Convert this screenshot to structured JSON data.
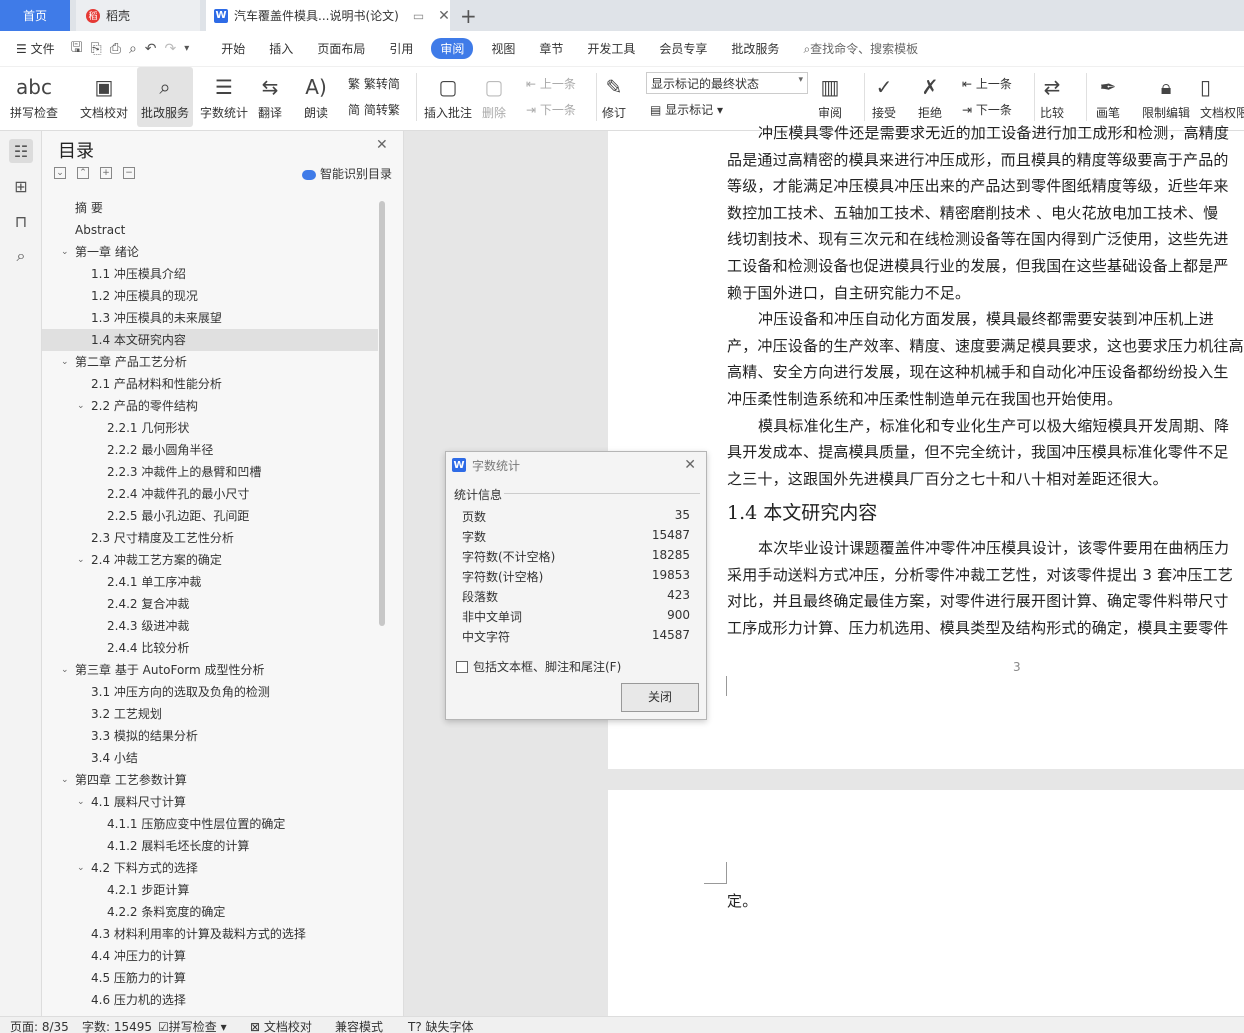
{
  "tabs": {
    "home": "首页",
    "daoke": "稻壳",
    "doc": "汽车覆盖件模具...说明书(论文)"
  },
  "menu": {
    "file": "文件",
    "items": [
      "开始",
      "插入",
      "页面布局",
      "引用",
      "审阅",
      "视图",
      "章节",
      "开发工具",
      "会员专享",
      "批改服务"
    ],
    "active_index": 4,
    "search": "查找命令、搜索模板"
  },
  "ribbon": {
    "spell": "拼写检查",
    "doc_check": "文档校对",
    "review_service": "批改服务",
    "word_count": "字数统计",
    "translate": "翻译",
    "read_aloud": "朗读",
    "trad": "繁转简",
    "simp": "简转繁",
    "insert_comment": "插入批注",
    "delete": "删除",
    "prev": "上一条",
    "next": "下一条",
    "revise": "修订",
    "mark_state": "显示标记的最终状态",
    "show_marks": "显示标记",
    "review": "审阅",
    "accept": "接受",
    "reject": "拒绝",
    "prev2": "上一条",
    "next2": "下一条",
    "compare": "比较",
    "pen": "画笔",
    "restrict": "限制编辑",
    "doc_rights": "文档权限"
  },
  "toc": {
    "title": "目录",
    "smart": "智能识别目录",
    "items": [
      {
        "t": "摘  要",
        "l": 0
      },
      {
        "t": "Abstract",
        "l": 0
      },
      {
        "t": "第一章  绪论",
        "l": 1
      },
      {
        "t": "1.1 冲压模具介绍",
        "l": 2
      },
      {
        "t": "1.2 冲压模具的现况",
        "l": 2
      },
      {
        "t": "1.3 冲压模具的未来展望",
        "l": 2
      },
      {
        "t": "1.4 本文研究内容",
        "l": 2,
        "sel": true
      },
      {
        "t": "第二章  产品工艺分析",
        "l": 1
      },
      {
        "t": "2.1 产品材料和性能分析",
        "l": 2
      },
      {
        "t": "2.2 产品的零件结构",
        "l": 3
      },
      {
        "t": "2.2.1  几何形状",
        "l": 4
      },
      {
        "t": "2.2.2 最小圆角半径",
        "l": 4
      },
      {
        "t": "2.2.3 冲裁件上的悬臂和凹槽",
        "l": 4
      },
      {
        "t": "2.2.4 冲裁件孔的最小尺寸",
        "l": 4
      },
      {
        "t": "2.2.5 最小孔边距、孔间距",
        "l": 4
      },
      {
        "t": "2.3 尺寸精度及工艺性分析",
        "l": 2
      },
      {
        "t": "2.4 冲裁工艺方案的确定",
        "l": 3
      },
      {
        "t": "2.4.1 单工序冲裁",
        "l": 4
      },
      {
        "t": "2.4.2 复合冲裁",
        "l": 4
      },
      {
        "t": "2.4.3 级进冲裁",
        "l": 4
      },
      {
        "t": "2.4.4 比较分析",
        "l": 4
      },
      {
        "t": "第三章  基于 AutoForm 成型性分析",
        "l": 1
      },
      {
        "t": "3.1  冲压方向的选取及负角的检测",
        "l": 2
      },
      {
        "t": "3.2  工艺规划",
        "l": 2
      },
      {
        "t": "3.3  模拟的结果分析",
        "l": 2
      },
      {
        "t": "3.4  小结",
        "l": 2
      },
      {
        "t": "第四章  工艺参数计算",
        "l": 1
      },
      {
        "t": "4.1 展料尺寸计算",
        "l": 3
      },
      {
        "t": "4.1.1 压筋应变中性层位置的确定",
        "l": 4
      },
      {
        "t": "4.1.2 展料毛坯长度的计算",
        "l": 4
      },
      {
        "t": "4.2 下料方式的选择",
        "l": 3
      },
      {
        "t": "4.2.1 步距计算",
        "l": 4
      },
      {
        "t": "4.2.2 条料宽度的确定",
        "l": 4
      },
      {
        "t": "4.3 材料利用率的计算及裁料方式的选择",
        "l": 2
      },
      {
        "t": "4.4 冲压力的计算",
        "l": 2
      },
      {
        "t": "4.5 压筋力的计算",
        "l": 2
      },
      {
        "t": "4.6 压力机的选择",
        "l": 2
      }
    ]
  },
  "doc": {
    "lines1": [
      "冲压模具零件还是需要求无近的加工设备进行加工成形和检测，高精度",
      "品是通过高精密的模具来进行冲压成形，而且模具的精度等级要高于产品的",
      "等级，才能满足冲压模具冲压出来的产品达到零件图纸精度等级，近些年来",
      "数控加工技术、五轴加工技术、精密磨削技术 、电火花放电加工技术、慢",
      "线切割技术、现有三次元和在线检测设备等在国内得到广泛使用，这些先进",
      "工设备和检测设备也促进模具行业的发展，但我国在这些基础设备上都是严",
      "赖于国外进口，自主研究能力不足。",
      "冲压设备和冲压自动化方面发展，模具最终都需要安装到冲压机上进",
      "产，冲压设备的生产效率、精度、速度要满足模具要求，这也要求压力机往高",
      "高精、安全方向进行发展，现在这种机械手和自动化冲压设备都纷纷投入生",
      "冲压柔性制造系统和冲压柔性制造单元在我国也开始使用。",
      "模具标准化生产，标准化和专业化生产可以极大缩短模具开发周期、降",
      "具开发成本、提高模具质量，但不完全统计，我国冲压模具标准化零件不足",
      "之三十，这跟国外先进模具厂百分之七十和八十相对差距还很大。"
    ],
    "heading": "1.4 本文研究内容",
    "lines2": [
      "本次毕业设计课题覆盖件冲零件冲压模具设计，该零件要用在曲柄压力",
      "采用手动送料方式冲压，分析零件冲裁工艺性，对该零件提出 3 套冲压工艺",
      "对比，并且最终确定最佳方案，对零件进行展开图计算、确定零件料带尺寸",
      "工序成形力计算、压力机选用、模具类型及结构形式的确定，模具主要零件"
    ],
    "page_number": "3",
    "page2_text": "定。"
  },
  "dialog": {
    "title": "字数统计",
    "section": "统计信息",
    "rows": [
      [
        "页数",
        "35"
      ],
      [
        "字数",
        "15487"
      ],
      [
        "字符数(不计空格)",
        "18285"
      ],
      [
        "字符数(计空格)",
        "19853"
      ],
      [
        "段落数",
        "423"
      ],
      [
        "非中文单词",
        "900"
      ],
      [
        "中文字符",
        "14587"
      ]
    ],
    "checkbox": "包括文本框、脚注和尾注(F)",
    "close": "关闭"
  },
  "status": {
    "page": "页面: 8/35",
    "words": "字数: 15495",
    "spell": "拼写检查",
    "check": "文档校对",
    "compat": "兼容模式",
    "font": "缺失字体"
  }
}
